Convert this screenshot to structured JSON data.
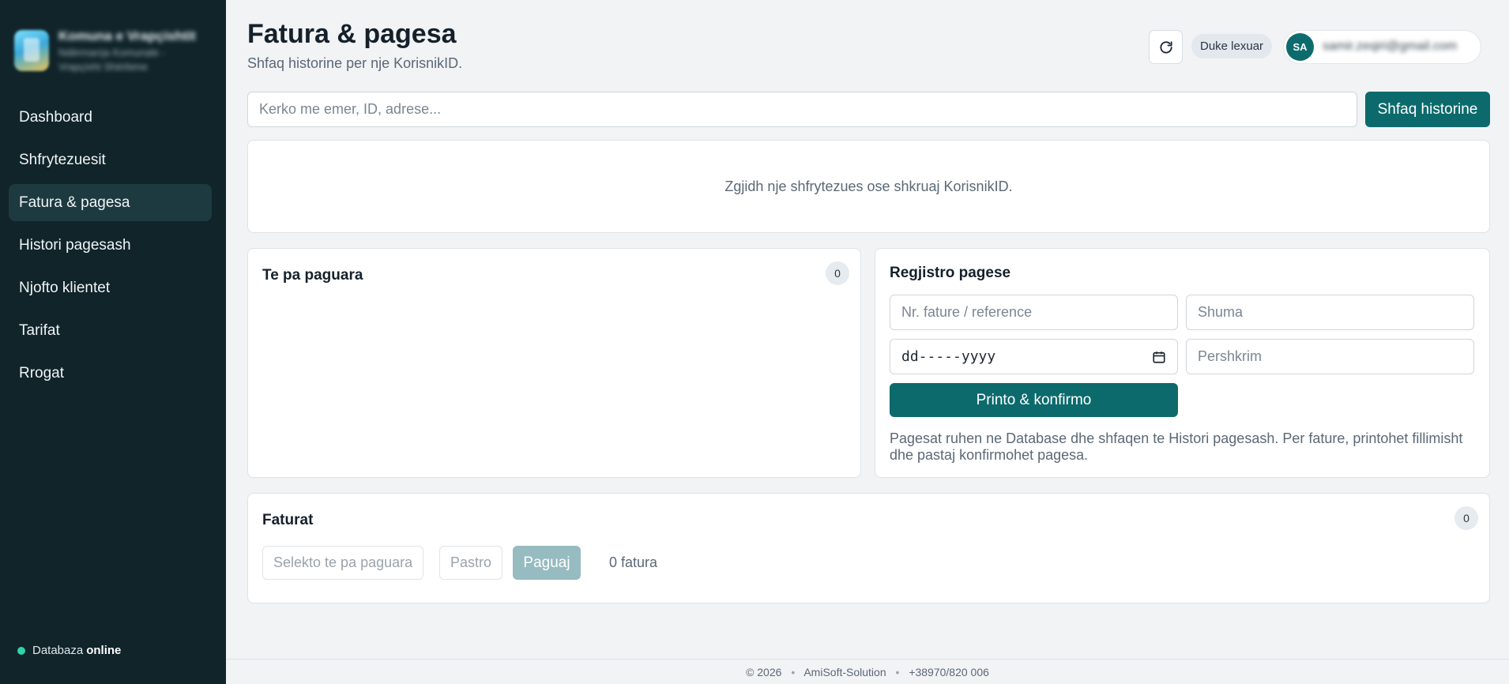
{
  "sidebar": {
    "brand_name": "Komuna e Vrapçishtit",
    "brand_sub": "Ndërmarrja Komunale - Vrapçisht Shërbime",
    "items": [
      {
        "label": "Dashboard"
      },
      {
        "label": "Shfrytezuesit"
      },
      {
        "label": "Fatura & pagesa",
        "active": true
      },
      {
        "label": "Histori pagesash"
      },
      {
        "label": "Njofto klientet"
      },
      {
        "label": "Tarifat"
      },
      {
        "label": "Rrogat"
      }
    ],
    "db_label": "Databaza",
    "db_status": "online",
    "db_status_color": "#2dd4a8"
  },
  "header": {
    "title": "Fatura & pagesa",
    "subtitle": "Shfaq historine per nje KorisnikID.",
    "status": "Duke lexuar",
    "avatar_initials": "SA",
    "user_email": "samir.zeqiri@gmail.com",
    "refresh_icon": "refresh-icon"
  },
  "search": {
    "placeholder": "Kerko me emer, ID, adrese...",
    "value": "",
    "button_label": "Shfaq historine"
  },
  "info": {
    "message": "Zgjidh nje shfrytezues ose shkruaj KorisnikID."
  },
  "unpaid": {
    "title": "Te pa paguara",
    "count": "0"
  },
  "payment": {
    "title": "Regjistro pagese",
    "reference_placeholder": "Nr. fature / reference",
    "amount_placeholder": "Shuma",
    "date_value": "dd-----yyyy",
    "calendar_icon": "calendar-icon",
    "description_placeholder": "Pershkrim",
    "confirm_label": "Printo & konfirmo",
    "note": "Pagesat ruhen ne Database dhe shfaqen te Histori pagesash. Per fature, printohet fillimisht dhe pastaj konfirmohet pagesa."
  },
  "invoices": {
    "title": "Faturat",
    "count": "0",
    "select_unpaid_label": "Selekto te pa paguara",
    "clear_label": "Pastro",
    "pay_label": "Paguaj",
    "selected_text": "0 fatura"
  },
  "footer": {
    "copyright": "© 2026",
    "company": "AmiSoft-Solution",
    "phone": "+38970/820 006"
  },
  "colors": {
    "sidebar_bg": "#10242a",
    "accent": "#0c6a6c",
    "page_bg": "#f1f3f5"
  }
}
